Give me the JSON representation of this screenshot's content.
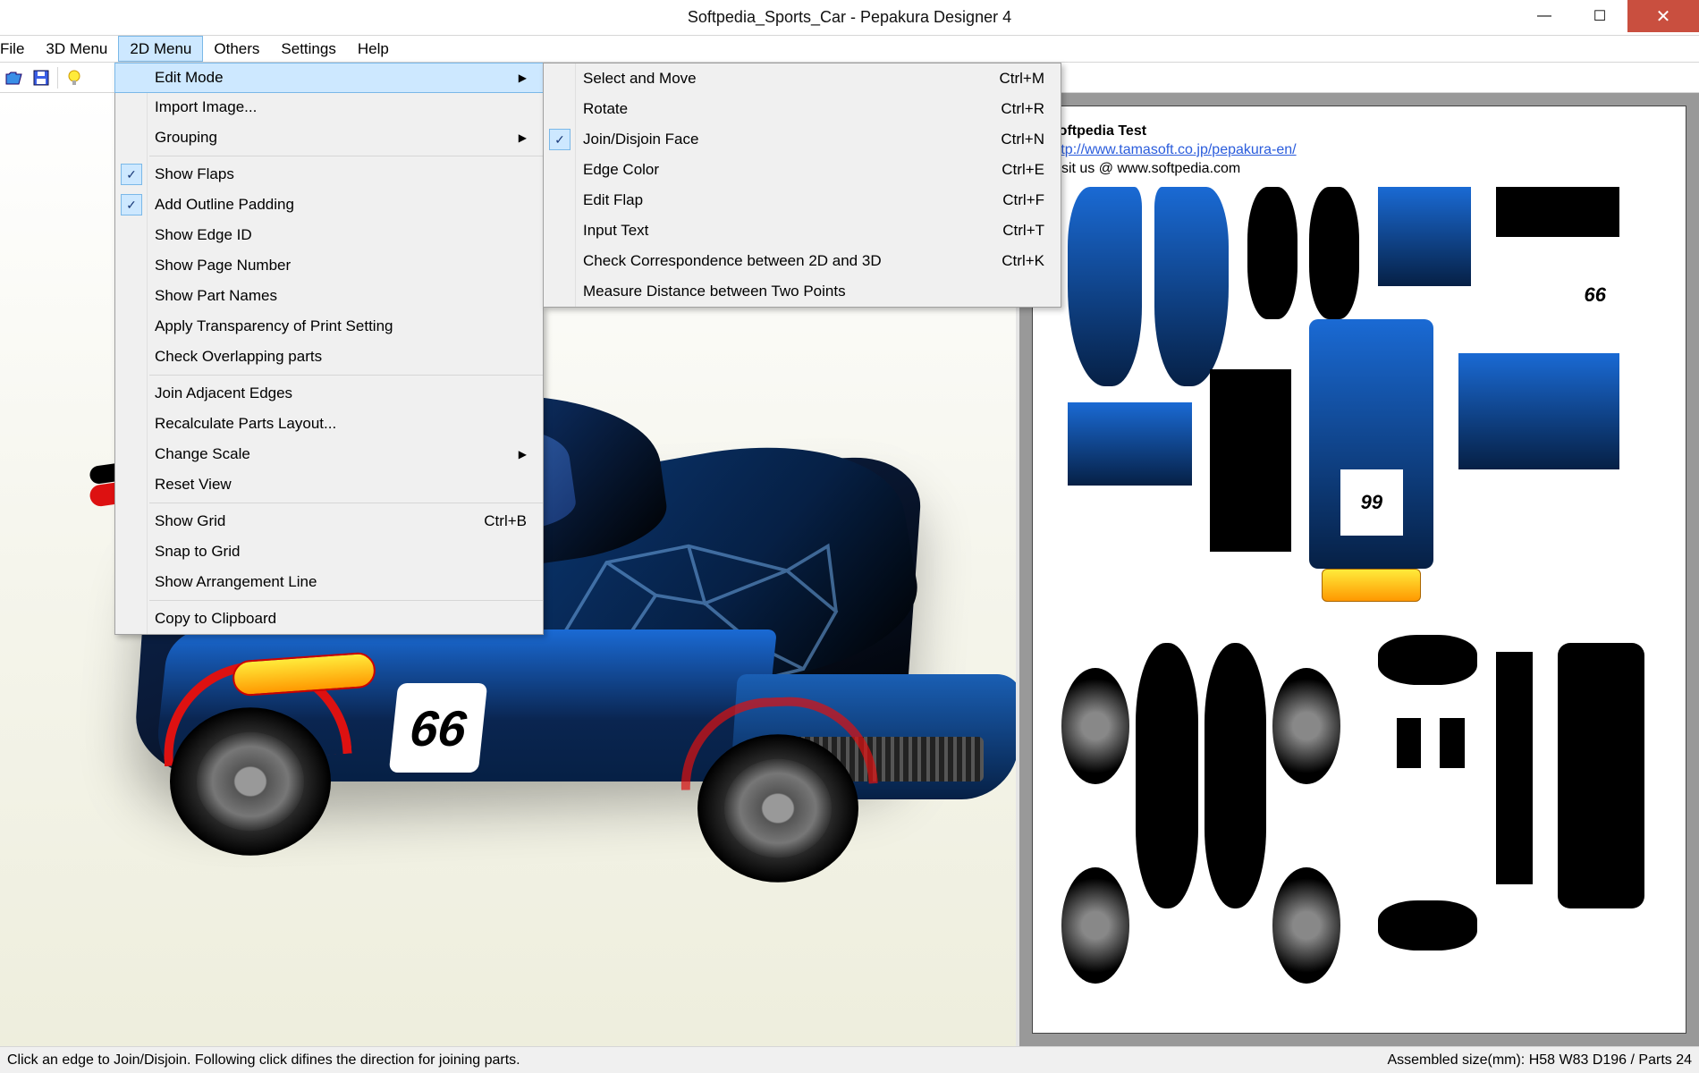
{
  "titlebar": {
    "title": "Softpedia_Sports_Car - Pepakura Designer 4"
  },
  "menubar": {
    "items": [
      "File",
      "3D Menu",
      "2D Menu",
      "Others",
      "Settings",
      "Help"
    ],
    "active_index": 2
  },
  "menu2d": {
    "items": [
      {
        "label": "Edit Mode",
        "submenu": true,
        "highlight": true
      },
      {
        "label": "Import Image..."
      },
      {
        "label": "Grouping",
        "submenu": true
      },
      {
        "sep": true
      },
      {
        "label": "Show Flaps",
        "checked": true
      },
      {
        "label": "Add Outline Padding",
        "checked": true
      },
      {
        "label": "Show Edge ID"
      },
      {
        "label": "Show Page Number"
      },
      {
        "label": "Show Part Names"
      },
      {
        "label": "Apply Transparency of Print Setting"
      },
      {
        "label": "Check Overlapping parts"
      },
      {
        "sep": true
      },
      {
        "label": "Join Adjacent Edges"
      },
      {
        "label": "Recalculate Parts Layout..."
      },
      {
        "label": "Change Scale",
        "submenu": true
      },
      {
        "label": "Reset View"
      },
      {
        "sep": true
      },
      {
        "label": "Show Grid",
        "shortcut": "Ctrl+B"
      },
      {
        "label": "Snap to Grid"
      },
      {
        "label": "Show Arrangement Line"
      },
      {
        "sep": true
      },
      {
        "label": "Copy to Clipboard"
      }
    ]
  },
  "submenu": {
    "items": [
      {
        "label": "Select and Move",
        "shortcut": "Ctrl+M"
      },
      {
        "label": "Rotate",
        "shortcut": "Ctrl+R"
      },
      {
        "label": "Join/Disjoin Face",
        "shortcut": "Ctrl+N",
        "checked": true
      },
      {
        "label": "Edge Color",
        "shortcut": "Ctrl+E"
      },
      {
        "label": "Edit Flap",
        "shortcut": "Ctrl+F"
      },
      {
        "label": "Input Text",
        "shortcut": "Ctrl+T"
      },
      {
        "label": "Check Correspondence between 2D and 3D",
        "shortcut": "Ctrl+K"
      },
      {
        "label": "Measure Distance between Two Points"
      }
    ]
  },
  "page_notes": {
    "l1": "Softpedia Test",
    "link": "http://www.tamasoft.co.jp/pepakura-en/",
    "l3": "Visit us @ www.softpedia.com"
  },
  "car": {
    "number_left": "66",
    "number_right": "99",
    "number_right_alt": "66"
  },
  "statusbar": {
    "left": "Click an edge to Join/Disjoin. Following click difines the direction for joining parts.",
    "right": "Assembled size(mm): H58 W83 D196 / Parts 24"
  }
}
